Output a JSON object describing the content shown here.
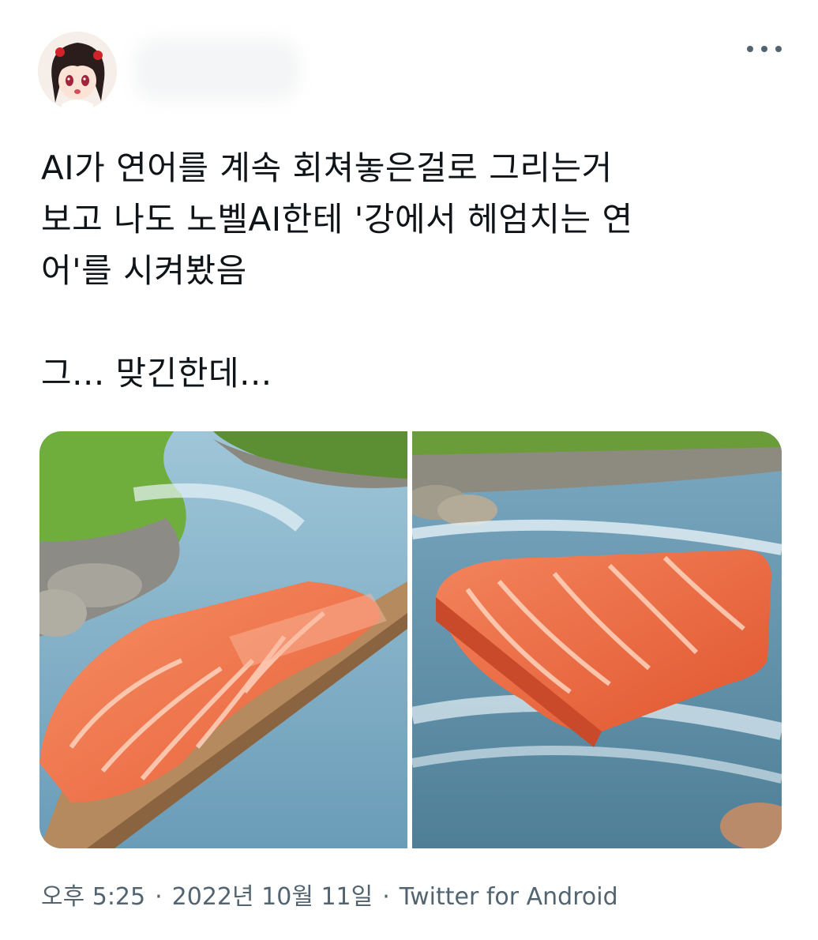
{
  "tweet": {
    "text": "AI가 연어를 계속 회쳐놓은걸로 그리는거\n보고 나도 노벨AI한테 '강에서 헤엄치는 연\n어'를 시켜봤음\n\n그... 맞긴한데...",
    "media": [
      {
        "icon": "salmon-fillet-on-raft-in-river-image"
      },
      {
        "icon": "salmon-fillet-in-rapids-image"
      }
    ],
    "time": "오후 5:25",
    "separator": "·",
    "date": "2022년 10월 11일",
    "source": "Twitter for Android"
  },
  "icons": {
    "avatar": "anime-girl-avatar",
    "more": "more-dots-icon"
  },
  "colors": {
    "text": "#0f1419",
    "secondary": "#536471",
    "salmon": "#f07a52",
    "water": "#7eb0cc",
    "grass": "#6fae3c"
  }
}
